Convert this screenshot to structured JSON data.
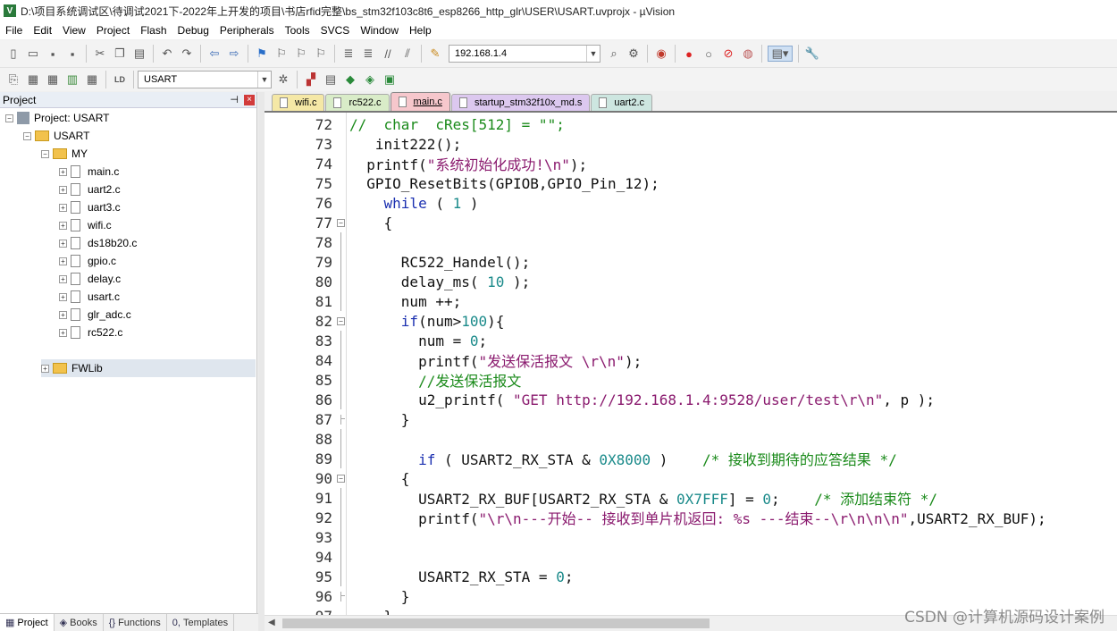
{
  "window": {
    "title": "D:\\项目系统调试区\\待调试2021下-2022年上开发的项目\\书店rfid完整\\bs_stm32f103c8t6_esp8266_http_glr\\USER\\USART.uvprojx - µVision"
  },
  "menu": [
    "File",
    "Edit",
    "View",
    "Project",
    "Flash",
    "Debug",
    "Peripherals",
    "Tools",
    "SVCS",
    "Window",
    "Help"
  ],
  "toolbar": {
    "address_value": "192.168.1.4",
    "target_value": "USART"
  },
  "project_panel": {
    "title": "Project",
    "root": "Project: USART",
    "group": "USART",
    "folder_my": "MY",
    "files": [
      "main.c",
      "uart2.c",
      "uart3.c",
      "wifi.c",
      "ds18b20.c",
      "gpio.c",
      "delay.c",
      "usart.c",
      "glr_adc.c",
      "rc522.c"
    ],
    "folder_fwlib": "FWLib"
  },
  "bottom_tabs": [
    "Project",
    "Books",
    "Functions",
    "Templates"
  ],
  "editor_tabs": [
    {
      "label": "wifi.c",
      "color": "#f5e8a6"
    },
    {
      "label": "rc522.c",
      "color": "#d9ecc8"
    },
    {
      "label": "main.c",
      "color": "#f6c7cc",
      "active": true
    },
    {
      "label": "startup_stm32f10x_md.s",
      "color": "#dcc8ef"
    },
    {
      "label": "uart2.c",
      "color": "#cde6e0"
    }
  ],
  "code_lines": [
    {
      "n": "72",
      "fold": "",
      "segs": [
        [
          "// ",
          "#1a8a1a"
        ],
        [
          " char  cRes[512] = \"\";",
          "#1a8a1a"
        ]
      ]
    },
    {
      "n": "73",
      "fold": "",
      "segs": [
        [
          "   init222();",
          "#111"
        ]
      ]
    },
    {
      "n": "74",
      "fold": "",
      "segs": [
        [
          "  printf(",
          "#111"
        ],
        [
          "\"系统初始化成功!\\n\"",
          "#8a1a6e"
        ],
        [
          ");",
          "#111"
        ]
      ]
    },
    {
      "n": "75",
      "fold": "",
      "segs": [
        [
          "  GPIO_ResetBits(GPIOB,GPIO_Pin_12);",
          "#111"
        ]
      ]
    },
    {
      "n": "76",
      "fold": "",
      "segs": [
        [
          "    ",
          "#111"
        ],
        [
          "while",
          "#1a2fb0"
        ],
        [
          " ( ",
          "#111"
        ],
        [
          "1",
          "#1a8a8a"
        ],
        [
          " )",
          "#111"
        ]
      ]
    },
    {
      "n": "77",
      "fold": "box",
      "segs": [
        [
          "    {",
          "#111"
        ]
      ]
    },
    {
      "n": "78",
      "fold": "line",
      "segs": [
        [
          "",
          "#111"
        ]
      ]
    },
    {
      "n": "79",
      "fold": "line",
      "segs": [
        [
          "      RC522_Handel();",
          "#111"
        ]
      ]
    },
    {
      "n": "80",
      "fold": "line",
      "segs": [
        [
          "      delay_ms( ",
          "#111"
        ],
        [
          "10",
          "#1a8a8a"
        ],
        [
          " );",
          "#111"
        ]
      ]
    },
    {
      "n": "81",
      "fold": "line",
      "segs": [
        [
          "      num ++;",
          "#111"
        ]
      ]
    },
    {
      "n": "82",
      "fold": "box",
      "segs": [
        [
          "      ",
          "#111"
        ],
        [
          "if",
          "#1a2fb0"
        ],
        [
          "(num>",
          "#111"
        ],
        [
          "100",
          "#1a8a8a"
        ],
        [
          "){",
          "#111"
        ]
      ]
    },
    {
      "n": "83",
      "fold": "line",
      "segs": [
        [
          "        num = ",
          "#111"
        ],
        [
          "0",
          "#1a8a8a"
        ],
        [
          ";",
          "#111"
        ]
      ]
    },
    {
      "n": "84",
      "fold": "line",
      "segs": [
        [
          "        printf(",
          "#111"
        ],
        [
          "\"发送保活报文 \\r\\n\"",
          "#8a1a6e"
        ],
        [
          ");",
          "#111"
        ]
      ]
    },
    {
      "n": "85",
      "fold": "line",
      "segs": [
        [
          "        //发送保活报文",
          "#1a8a1a"
        ]
      ]
    },
    {
      "n": "86",
      "fold": "line",
      "segs": [
        [
          "        u2_printf( ",
          "#111"
        ],
        [
          "\"GET http://192.168.1.4:9528/user/test\\r\\n\"",
          "#8a1a6e"
        ],
        [
          ", p );",
          "#111"
        ]
      ]
    },
    {
      "n": "87",
      "fold": "end",
      "segs": [
        [
          "      }",
          "#111"
        ]
      ]
    },
    {
      "n": "88",
      "fold": "line",
      "segs": [
        [
          "",
          "#111"
        ]
      ]
    },
    {
      "n": "89",
      "fold": "line",
      "segs": [
        [
          "        ",
          "#111"
        ],
        [
          "if",
          "#1a2fb0"
        ],
        [
          " ( USART2_RX_STA & ",
          "#111"
        ],
        [
          "0X8000",
          "#1a8a8a"
        ],
        [
          " )    ",
          "#111"
        ],
        [
          "/* 接收到期待的应答结果 */",
          "#1a8a1a"
        ]
      ]
    },
    {
      "n": "90",
      "fold": "box",
      "segs": [
        [
          "      {",
          "#111"
        ]
      ]
    },
    {
      "n": "91",
      "fold": "line",
      "segs": [
        [
          "        USART2_RX_BUF[USART2_RX_STA & ",
          "#111"
        ],
        [
          "0X7FFF",
          "#1a8a8a"
        ],
        [
          "] = ",
          "#111"
        ],
        [
          "0",
          "#1a8a8a"
        ],
        [
          ";    ",
          "#111"
        ],
        [
          "/* 添加结束符 */",
          "#1a8a1a"
        ]
      ]
    },
    {
      "n": "92",
      "fold": "line",
      "segs": [
        [
          "        printf(",
          "#111"
        ],
        [
          "\"\\r\\n---开始-- 接收到单片机返回: %s ---结束--\\r\\n\\n\\n\"",
          "#8a1a6e"
        ],
        [
          ",USART2_RX_BUF);",
          "#111"
        ]
      ]
    },
    {
      "n": "93",
      "fold": "line",
      "segs": [
        [
          "",
          "#111"
        ]
      ]
    },
    {
      "n": "94",
      "fold": "line",
      "segs": [
        [
          "",
          "#111"
        ]
      ]
    },
    {
      "n": "95",
      "fold": "line",
      "segs": [
        [
          "        USART2_RX_STA = ",
          "#111"
        ],
        [
          "0",
          "#1a8a8a"
        ],
        [
          ";",
          "#111"
        ]
      ]
    },
    {
      "n": "96",
      "fold": "end",
      "segs": [
        [
          "      }",
          "#111"
        ]
      ]
    },
    {
      "n": "97",
      "fold": "",
      "segs": [
        [
          "    }",
          "#111"
        ]
      ]
    }
  ],
  "watermark": "CSDN @计算机源码设计案例"
}
